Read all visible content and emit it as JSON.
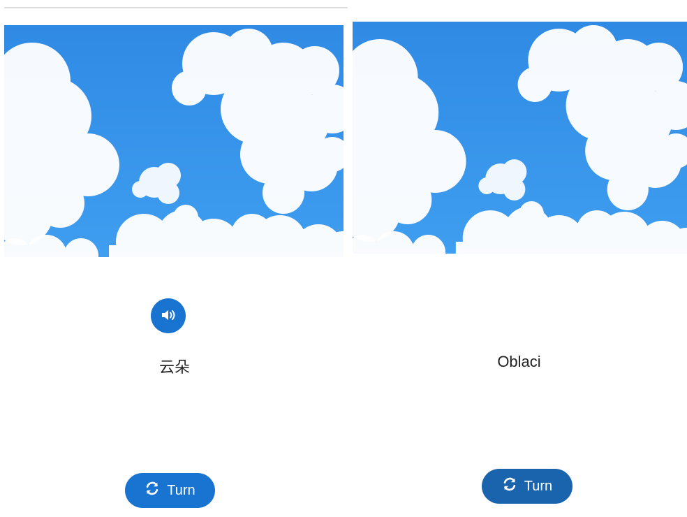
{
  "left_card": {
    "image_name": "clouds-sky-image",
    "audio_icon": "speaker-icon",
    "word": "云朵",
    "turn_icon": "refresh-icon",
    "turn_label": "Turn"
  },
  "right_card": {
    "image_name": "clouds-sky-image",
    "word": "Oblaci",
    "turn_icon": "refresh-icon",
    "turn_label": "Turn"
  },
  "colors": {
    "primary": "#1874d0",
    "primary_dark": "#1a63ad",
    "sky": "#2d8be6"
  }
}
